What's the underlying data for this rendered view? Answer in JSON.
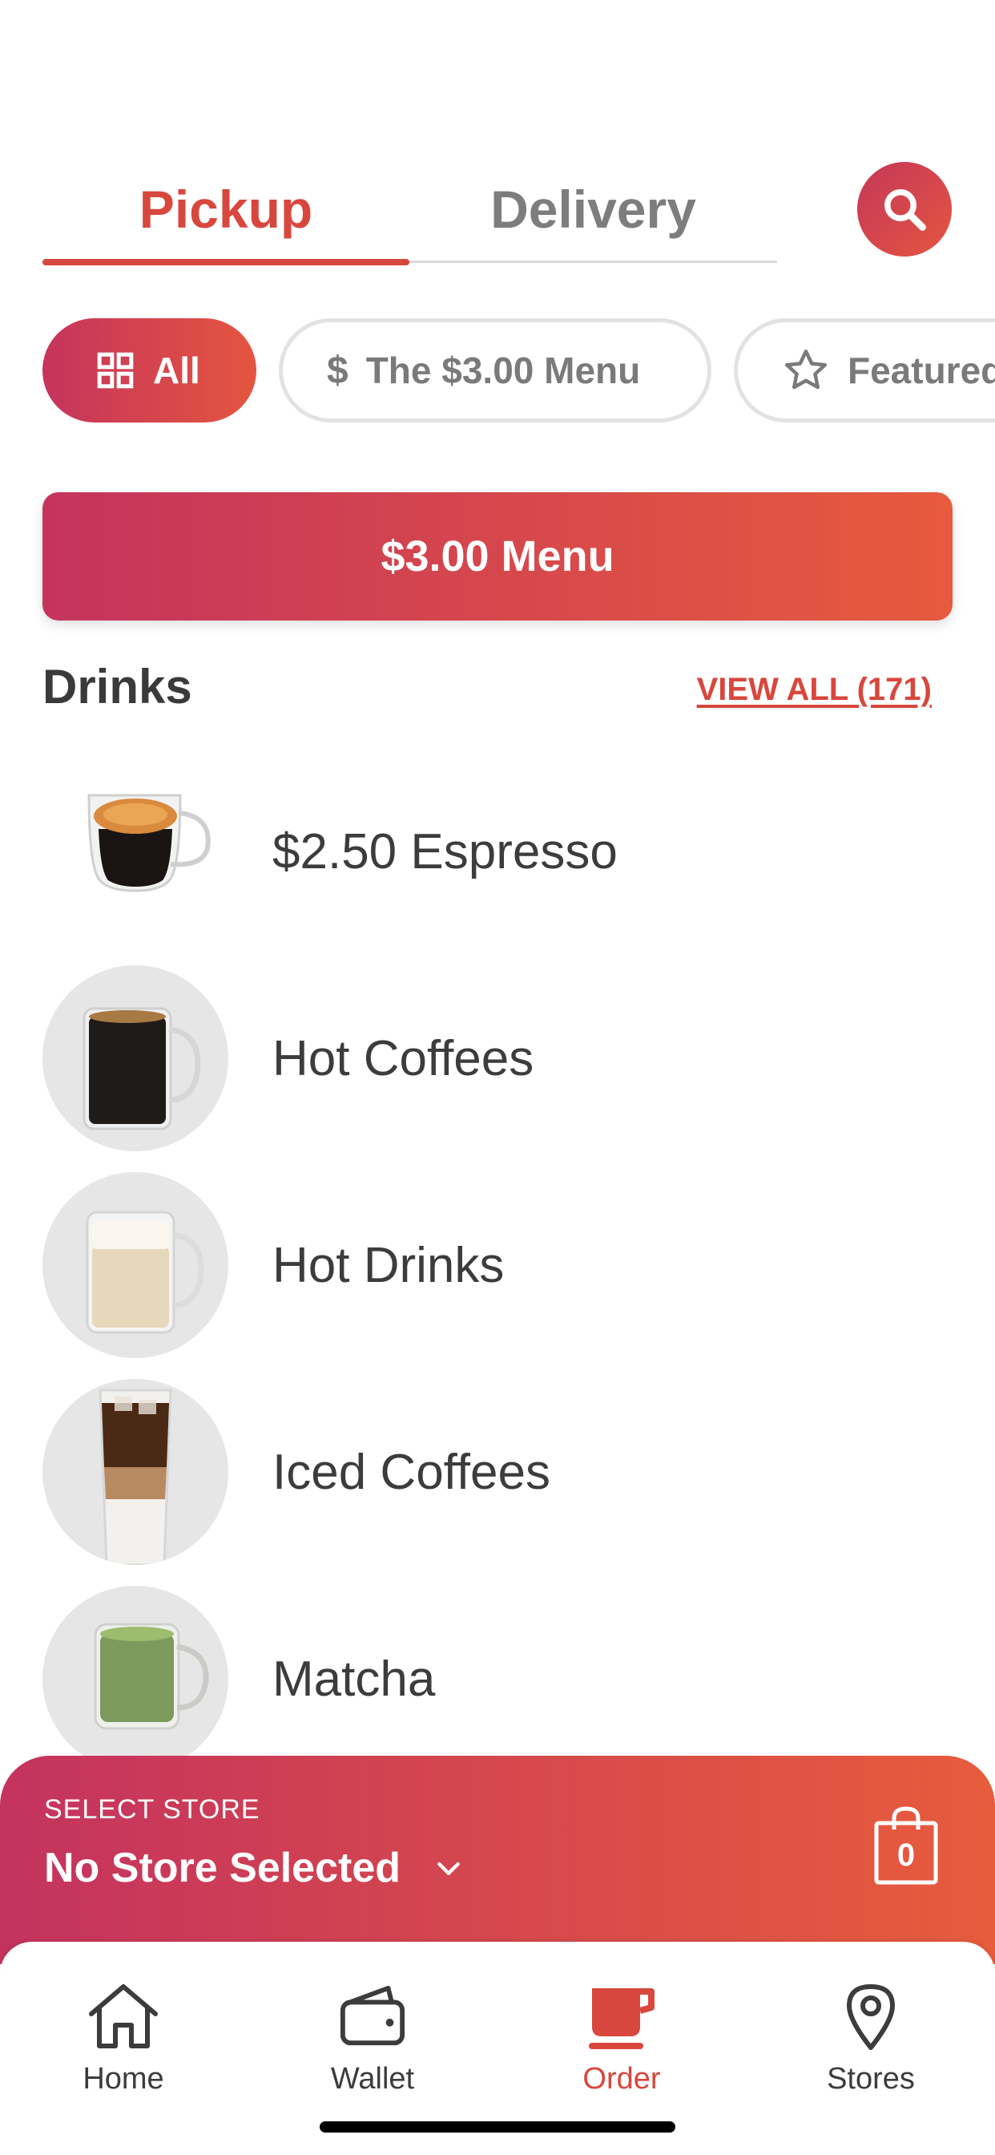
{
  "tabs": {
    "pickup": "Pickup",
    "delivery": "Delivery"
  },
  "filters": [
    {
      "label": "All",
      "icon": "grid-icon"
    },
    {
      "label": "The $3.00 Menu",
      "icon": "dollar-icon"
    },
    {
      "label": "Featured",
      "icon": "star-icon"
    }
  ],
  "banner": {
    "label": "$3.00 Menu"
  },
  "section": {
    "title": "Drinks",
    "view_all": "VIEW ALL (171)"
  },
  "items": [
    {
      "label": "$2.50 Espresso"
    },
    {
      "label": "Hot Coffees"
    },
    {
      "label": "Hot Drinks"
    },
    {
      "label": "Iced Coffees"
    },
    {
      "label": "Matcha"
    }
  ],
  "store": {
    "caption": "SELECT STORE",
    "name": "No Store Selected",
    "cart_count": "0"
  },
  "nav": [
    {
      "label": "Home",
      "icon": "home-icon"
    },
    {
      "label": "Wallet",
      "icon": "wallet-icon"
    },
    {
      "label": "Order",
      "icon": "coffee-cup-icon"
    },
    {
      "label": "Stores",
      "icon": "location-pin-icon"
    }
  ],
  "colors": {
    "accent": "#d8473d",
    "gradient_start": "#c5345c",
    "gradient_end": "#e75a3d"
  }
}
